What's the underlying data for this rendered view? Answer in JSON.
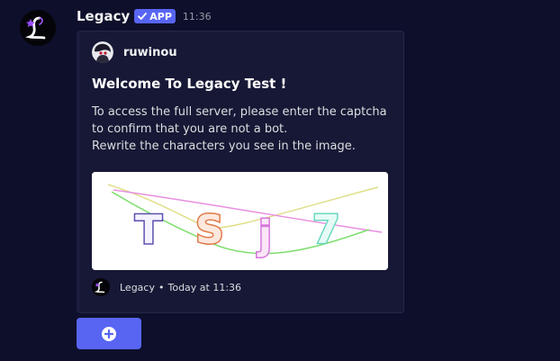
{
  "message": {
    "username": "Legacy",
    "badge": "APP",
    "timestamp": "11:36"
  },
  "embed": {
    "author": "ruwinou",
    "title": "Welcome To Legacy Test !",
    "description_lines": [
      "To access the full server, please enter the captcha",
      "to confirm that you are not a bot.",
      "Rewrite the characters you see in the image."
    ],
    "captcha_characters": [
      "T",
      "S",
      "j",
      "7"
    ],
    "footer": {
      "name": "Legacy",
      "separator": "•",
      "time": "Today at 11:36"
    }
  },
  "action_button": {
    "icon": "plus-circle-icon"
  },
  "colors": {
    "background": "#0e0f2b",
    "embed_background": "#161835",
    "blurple": "#5865f2",
    "timestamp": "#949ba4"
  }
}
